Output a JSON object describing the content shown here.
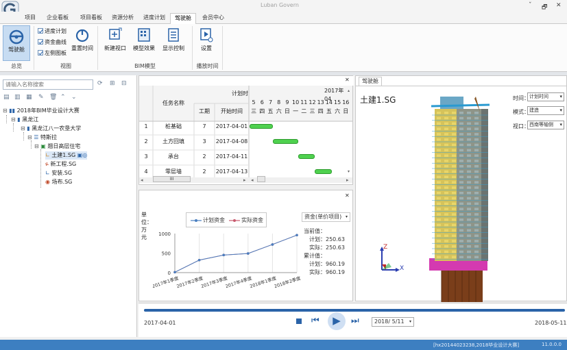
{
  "window": {
    "title": "Luban Govern",
    "controls": [
      "ˇ",
      "🗗",
      "✕"
    ]
  },
  "tabs": [
    "项目",
    "企业看板",
    "项目看板",
    "资源分析",
    "进度计划",
    "驾驶舱",
    "会员中心"
  ],
  "ribbon": {
    "cockpit_label": "驾驶舱",
    "checks": [
      "进度计划",
      "资金曲线",
      "左侧图板"
    ],
    "reset_time_label": "重置时间",
    "new_view_label": "新建视口",
    "model_effect_label": "模型效果",
    "display_control_label": "显示控制",
    "settings_label": "设置",
    "groups": [
      "总览",
      "视图",
      "BIM模型",
      "播放时间"
    ]
  },
  "left": {
    "search_placeholder": "请输入名称搜索",
    "tree": [
      {
        "label": "2018年BIM毕业设计大赛"
      },
      {
        "label": "黑龙江"
      },
      {
        "label": "黑龙江八一农垦大学"
      },
      {
        "label": "特斯拉"
      },
      {
        "label": "翘日高层住宅"
      },
      {
        "label": "土建1.SG"
      },
      {
        "label": "新工程.SG"
      },
      {
        "label": "安装.SG"
      },
      {
        "label": "场布.SG"
      }
    ]
  },
  "gantt": {
    "headers": {
      "task": "任务名称",
      "plan": "计划时",
      "duration": "工期",
      "start": "开始时间",
      "month": "2017年04"
    },
    "days": [
      "5",
      "6",
      "7",
      "8",
      "9",
      "10",
      "11",
      "12",
      "13",
      "14",
      "15",
      "16"
    ],
    "weekdays": [
      "三",
      "四",
      "五",
      "六",
      "日",
      "一",
      "二",
      "三",
      "四",
      "五",
      "六",
      "日"
    ],
    "rows": [
      {
        "no": "1",
        "name": "桩基础",
        "duration": "7",
        "start": "2017-04-01",
        "bar_start": 0,
        "bar_len": 2.8
      },
      {
        "no": "2",
        "name": "土方回填",
        "duration": "3",
        "start": "2017-04-08",
        "bar_start": 2.8,
        "bar_len": 3
      },
      {
        "no": "3",
        "name": "承台",
        "duration": "2",
        "start": "2017-04-11",
        "bar_start": 5.8,
        "bar_len": 2
      },
      {
        "no": "4",
        "name": "零层墙",
        "duration": "2",
        "start": "2017-04-13",
        "bar_start": 7.8,
        "bar_len": 2
      }
    ],
    "scroll_label": "III"
  },
  "chart_data": {
    "type": "line",
    "ylabel": "单位：万元",
    "categories": [
      "2017年1季度",
      "2017年2季度",
      "2017年3季度",
      "2017年4季度",
      "2018年1季度",
      "2018年2季度"
    ],
    "series": [
      {
        "name": "计划资金",
        "values": [
          10,
          320,
          450,
          490,
          720,
          960
        ],
        "color": "#4a7fc0"
      },
      {
        "name": "实际资金",
        "values": [
          10,
          320,
          450,
          490,
          720,
          960
        ],
        "color": "#c85a6e"
      }
    ],
    "yticks": [
      "0",
      "500",
      "1000"
    ],
    "ylim": [
      0,
      1000
    ]
  },
  "fund": {
    "selector": "资金(单价项目)",
    "current_title": "当前值：",
    "current_plan": "计划：250.63",
    "current_actual": "实际：250.63",
    "cumulative_title": "累计值：",
    "cumulative_plan": "计划：960.19",
    "cumulative_actual": "实际：960.19"
  },
  "viewer": {
    "tab": "驾驶舱",
    "model_title": "土建1.SG",
    "time_label": "时间：",
    "time_value": "计划时间",
    "mode_label": "模式：",
    "mode_value": "建造",
    "view_label": "视口：",
    "view_value": "西南等轴侧",
    "axis_z": "Z",
    "axis_x": "X"
  },
  "timeline": {
    "start": "2017-04-01",
    "end": "2018-05-11",
    "current": "2018/ 5/11"
  },
  "status": {
    "user": "[hx20144023238,2018毕业设计大赛]",
    "version": "11.0.0.0"
  }
}
